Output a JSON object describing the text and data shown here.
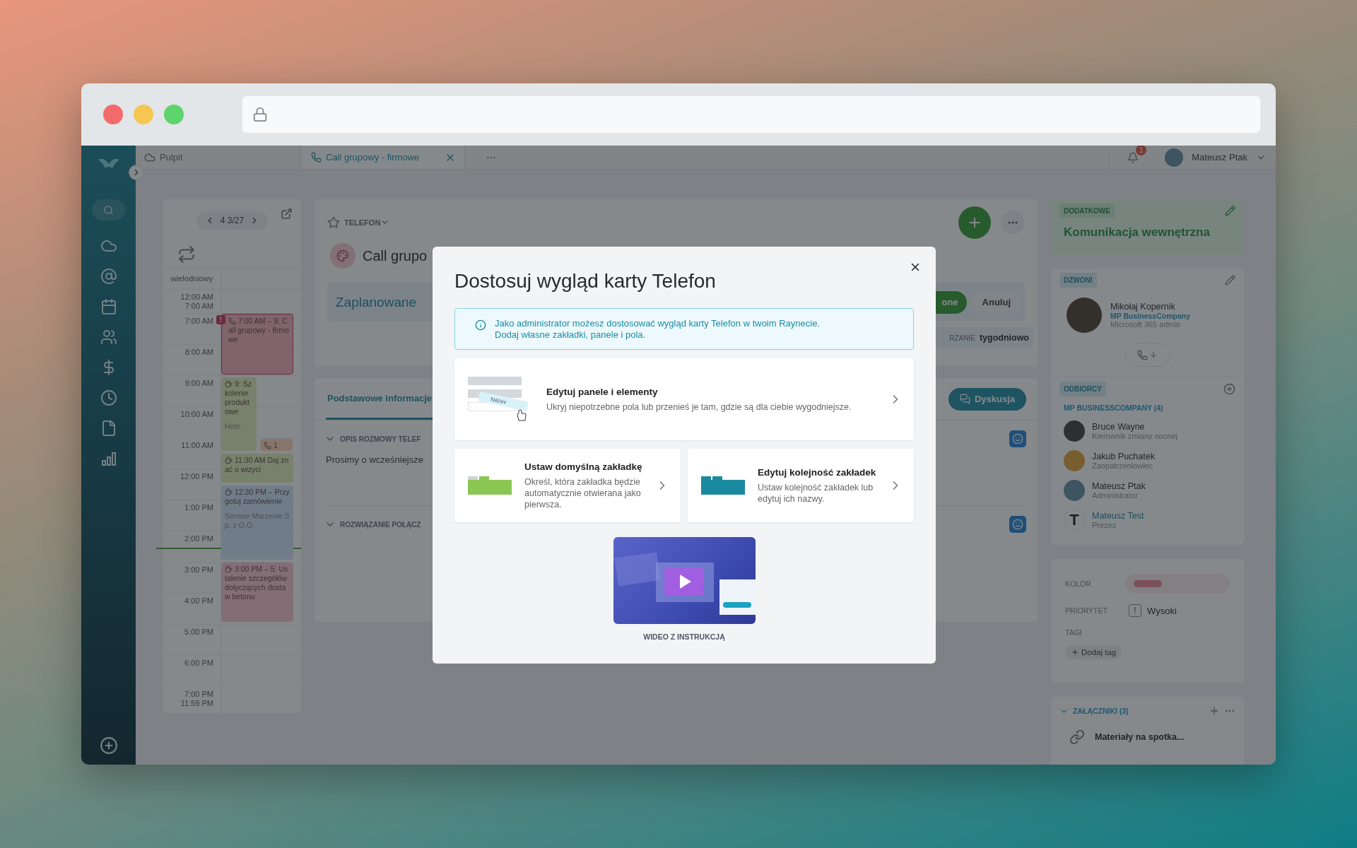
{
  "browser": {
    "traffic_lights": [
      {
        "color": "#f26a6a"
      },
      {
        "color": "#f7c652"
      },
      {
        "color": "#5fd36c"
      }
    ]
  },
  "tabs": [
    {
      "kind": "dashboard",
      "label": "Pulpit",
      "selected": false
    },
    {
      "kind": "call",
      "label": "Call grupowy - firmowe",
      "selected": true
    }
  ],
  "user": {
    "name": "Mateusz Ptak",
    "notifications": "1"
  },
  "calendar": {
    "date": "4 3/27",
    "allday_label": "wielodniowy",
    "time_rows": [
      {
        "labels": [
          "12:00 AM",
          "7:00 AM"
        ]
      },
      {
        "labels": [
          "7:00 AM"
        ]
      },
      {
        "labels": [
          "8:00 AM"
        ]
      },
      {
        "labels": [
          "9:00 AM"
        ]
      },
      {
        "labels": [
          "10:00 AM"
        ]
      },
      {
        "labels": [
          "11:00 AM"
        ]
      },
      {
        "labels": [
          "12:00 PM"
        ]
      },
      {
        "labels": [
          "1:00 PM"
        ]
      },
      {
        "labels": [
          "2:00 PM"
        ]
      },
      {
        "labels": [
          "3:00 PM"
        ]
      },
      {
        "labels": [
          "4:00 PM"
        ]
      },
      {
        "labels": [
          "5:00 PM"
        ]
      },
      {
        "labels": [
          "6:00 PM"
        ]
      },
      {
        "labels": [
          "7:00 PM",
          "11:59 PM"
        ]
      }
    ],
    "events": [
      {
        "kind": "call",
        "time": "7:00 AM – 9:",
        "title": "Call grupowy - firmowe",
        "color": "#81636b",
        "alert": "!"
      },
      {
        "kind": "meeting",
        "time": "9:",
        "title": "Szkolenie produktowe",
        "footer": "Hote",
        "color": "#78816a"
      },
      {
        "kind": "call",
        "time": "1",
        "color": "#85756a"
      },
      {
        "kind": "meeting",
        "time": "11:30 AM",
        "title": "Daj znać o wizyci",
        "color": "#78816a"
      },
      {
        "kind": "meeting",
        "time": "12:30 PM –",
        "title": "Przygotuj zamówienie",
        "footer": "Serowe Marzenie Sp. z O.O.",
        "color": "#707d87"
      },
      {
        "kind": "meeting",
        "time": "3:00 PM – 5:",
        "title": "Ustalenie szczegółów dotyczących dostaw betonu",
        "color": "#826e73"
      }
    ]
  },
  "record": {
    "type": "TELEFON",
    "title": "Call grupo",
    "status": "Zaplanowane",
    "actions": [
      "one",
      "Anuluj"
    ],
    "repeat_label": "RZANIE",
    "repeat_value": "tygodniowo"
  },
  "details": {
    "tabs": [
      {
        "label": "Podstawowe informacje",
        "selected": true
      }
    ],
    "discussion_button": "Dyskusja",
    "sections": [
      {
        "title": "OPIS ROZMOWY TELEF",
        "text": "Prosimy o wcześniejsze",
        "expanded": true
      },
      {
        "title": "ROZWIĄZANIE POŁĄCZ",
        "expanded": true
      }
    ]
  },
  "right_panel": {
    "extra": {
      "tag": "DODATKOWE",
      "value": "Komunikacja wewnętrzna"
    },
    "caller": {
      "tag": "DZWONI",
      "name": "Mikołaj Kopernik",
      "company": "MP BusinessCompany",
      "role": "Microsoft 365 admin"
    },
    "recipients": {
      "tag": "ODBIORCY",
      "group": "MP BUSINESSCOMPANY (4)",
      "people": [
        {
          "kind": "image",
          "name": "Bruce Wayne",
          "role": "Kierownik zmiany nocnej"
        },
        {
          "kind": "image",
          "name": "Jakub Puchatek",
          "role": "Zaopatrzeniowiec"
        },
        {
          "kind": "image",
          "name": "Mateusz Ptak",
          "role": "Administrator"
        },
        {
          "kind": "letter",
          "initial": "T",
          "name": "Mateusz Test",
          "role": "Prezes"
        }
      ]
    },
    "properties": {
      "color_label": "KOLOR",
      "color": "#7c5059",
      "priority_label": "PRIORYTET",
      "priority_mark": "!",
      "priority": "Wysoki",
      "tags_label": "TAGI",
      "add_tag": "Dodaj tag"
    },
    "attachments": {
      "title": "ZAŁĄCZNIKI (3)",
      "expanded": true,
      "items": [
        "Materiały na spotka..."
      ]
    }
  },
  "modal": {
    "title": "Dostosuj wygląd karty Telefon",
    "info": "Jako administrator możesz dostosować wygląd karty Telefon w twoim Raynecie.\nDodaj własne zakładki, panele i pola.",
    "options": [
      {
        "kind": "panels",
        "title": "Edytuj panele i elementy",
        "description": "Ukryj niepotrzebne pola lub przenieś je tam, gdzie są dla ciebie wygodniejsze.",
        "illustration_label": "Název"
      },
      {
        "kind": "default_tab",
        "title": "Ustaw domyślną zakładkę",
        "description": "Określ, która zakładka będzie automatycznie otwierana jako pierwsza."
      },
      {
        "kind": "tab_order",
        "title": "Edytuj kolejność zakładek",
        "description": "Ustaw kolejność zakładek lub edytuj ich nazwy."
      }
    ],
    "video_caption": "WIDEO Z INSTRUKCJĄ"
  }
}
